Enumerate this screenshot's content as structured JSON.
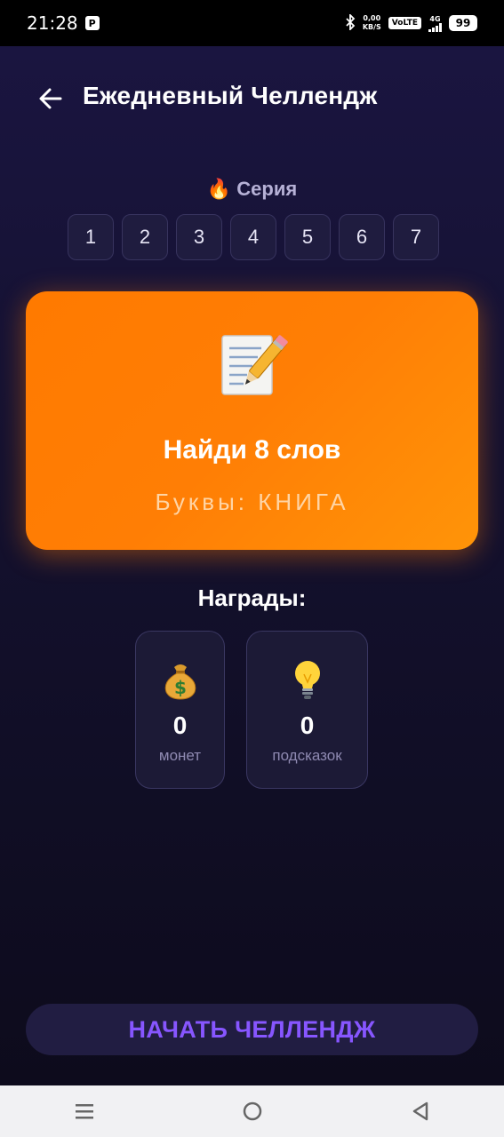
{
  "status_bar": {
    "time": "21:28",
    "speed_value": "0,00",
    "speed_unit": "KB/S",
    "volte": "VoLTE",
    "network": "4G",
    "battery": "99"
  },
  "header": {
    "title": "Ежедневный Челлендж",
    "back_icon": "arrow-left-icon"
  },
  "streak": {
    "label": "🔥 Серия",
    "days": [
      "1",
      "2",
      "3",
      "4",
      "5",
      "6",
      "7"
    ]
  },
  "challenge": {
    "icon": "📝",
    "title": "Найди 8 слов",
    "letters_label": "Буквы:",
    "letters": "КНИГА",
    "colors": {
      "card_start": "#ff7a00",
      "card_end": "#ff9408"
    }
  },
  "rewards": {
    "title": "Награды:",
    "items": [
      {
        "icon": "💰",
        "value": "0",
        "label": "монет"
      },
      {
        "icon": "💡",
        "value": "0",
        "label": "подсказок"
      }
    ]
  },
  "start_button": {
    "label": "НАЧАТЬ ЧЕЛЛЕНДЖ",
    "color": "#8756ff"
  },
  "nav": {
    "menu_icon": "menu-icon",
    "home_icon": "home-icon",
    "back_icon": "back-triangle-icon"
  }
}
